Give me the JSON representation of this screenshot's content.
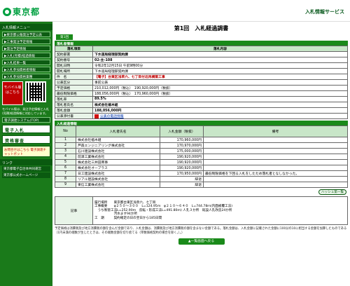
{
  "header": {
    "logo_text": "東京都",
    "service_title": "入札情報サービス"
  },
  "sidebar": {
    "menu_head": "入札情報メニュー",
    "items": [
      {
        "label": "▶東京都公報発注予定公表"
      },
      {
        "label": "▶工事発注予定情報"
      },
      {
        "label": "▶発注予定情報"
      },
      {
        "label": "▶入札(見積)経過情報"
      },
      {
        "label": "▶入札結果一覧"
      },
      {
        "label": "▶入札参加資格者情報"
      },
      {
        "label": "▶入札参加資格業種"
      }
    ],
    "mobile_label": "モバイル版 はこちら",
    "mobile_text": "モバイル版は、発注予定情報と入札(見積)経過情報に対応しています。",
    "link_head": "電子調達システム(TOP)",
    "big_buttons": [
      {
        "label": "電子入札"
      },
      {
        "label": "資格審査"
      }
    ],
    "yellow_label": "お問合せはこちら 電子調達チャットボット",
    "links_head": "リンク",
    "links": [
      {
        "label": "東京都電子自治体共同運営"
      },
      {
        "label": "東京都公式ホームページ"
      }
    ]
  },
  "main": {
    "page_title": "第1回　入札経過調書",
    "round_tab": "第1回",
    "info_section": "落札者情報",
    "info_headers": [
      "落札項目",
      "落札内容"
    ],
    "info_rows": [
      {
        "k": "契約部署",
        "v": "下水道局経理部契約課",
        "style": "bold"
      },
      {
        "k": "契約番号",
        "v": "02-主-108",
        "style": "bold"
      },
      {
        "k": "開札日時",
        "v": "令和2年12月15日 午前9時00分",
        "style": ""
      },
      {
        "k": "開札場所",
        "v": "下水道局経理部契約課",
        "style": ""
      },
      {
        "k": "件　名",
        "v": "【電子】台東区浅草六、七丁目付近再構築工事",
        "style": "red"
      },
      {
        "k": "公表区分",
        "v": "事前公表",
        "style": ""
      },
      {
        "k": "予定価格",
        "v": "210,012,000円（税込）　190,920,000円（税抜）",
        "style": ""
      },
      {
        "k": "最低制限価格",
        "v": "188,056,000円（税込）　170,960,000円（税抜）",
        "style": ""
      },
      {
        "k": "落札率",
        "v": "89.5%",
        "style": "bold"
      },
      {
        "k": "落札者氏名",
        "v": "株式会社植木組",
        "style": "bold"
      },
      {
        "k": "落札金額",
        "v": "188,056,000円",
        "style": "bold"
      },
      {
        "k": "公表添付書",
        "v": "公表の電話情報",
        "style": "pdf"
      }
    ],
    "bids_section": "入札経過情報",
    "bids_headers": [
      "No",
      "入札者氏名",
      "入札金額（税抜）",
      "備考"
    ],
    "bids": [
      {
        "no": "1",
        "name": "株式会社植木組",
        "amount": "170,960,000円",
        "note": ""
      },
      {
        "no": "2",
        "name": "芦森エンジニアリング株式会社",
        "amount": "170,970,000円",
        "note": ""
      },
      {
        "no": "3",
        "name": "石川建設株式会社",
        "amount": "175,000,000円",
        "note": ""
      },
      {
        "no": "4",
        "name": "前澤工業株式会社",
        "amount": "190,920,000円",
        "note": ""
      },
      {
        "no": "5",
        "name": "株式会社三井田商事",
        "amount": "190,920,000円",
        "note": ""
      },
      {
        "no": "6",
        "name": "株式会社オーブラス",
        "amount": "190,920,000円",
        "note": ""
      },
      {
        "no": "7",
        "name": "日工建設株式会社",
        "amount": "170,950,000円",
        "note": "最低制限価格を下回る入札をしたため落札者となしなかった。"
      },
      {
        "no": "8",
        "name": "リアル建設株式会社",
        "amount": "辞退",
        "note": ""
      },
      {
        "no": "9",
        "name": "東信工業株式会社",
        "amount": "辞退",
        "note": ""
      }
    ],
    "help_button": "ハッシュ第一覧",
    "memo_key": "記事",
    "memo_lines": [
      "履行場所　　東京都台東区浅草六、七丁目",
      "工事概要　　φ２５０～３００　L=124.95ｍ　φ２１０～６４０　L=744.78ｍ(内面被覆工法)",
      "　うち製管工法L=252.90ｍ　反転・形成工法L=491.80ｍ) 人孔３か所　既設人孔改造24か所",
      "　　　　　　汚水ます94か所",
      "工　期　　　契約確定の日の翌日から185日間"
    ],
    "note": "予定価格は消費税及び地方消費税の額を含んだ金額であり、入札金額は、消費税及び地方消費税の額を含まない金額である。落札金額は、入札金額に記載された金額に100分の10に相当する金額を加算したものである（1円未満の端数が生じたときは、その端数金額を切り捨てる（単数価格契約の場合を除く。）。）",
    "back_button": "▲一覧画面へ戻る"
  }
}
